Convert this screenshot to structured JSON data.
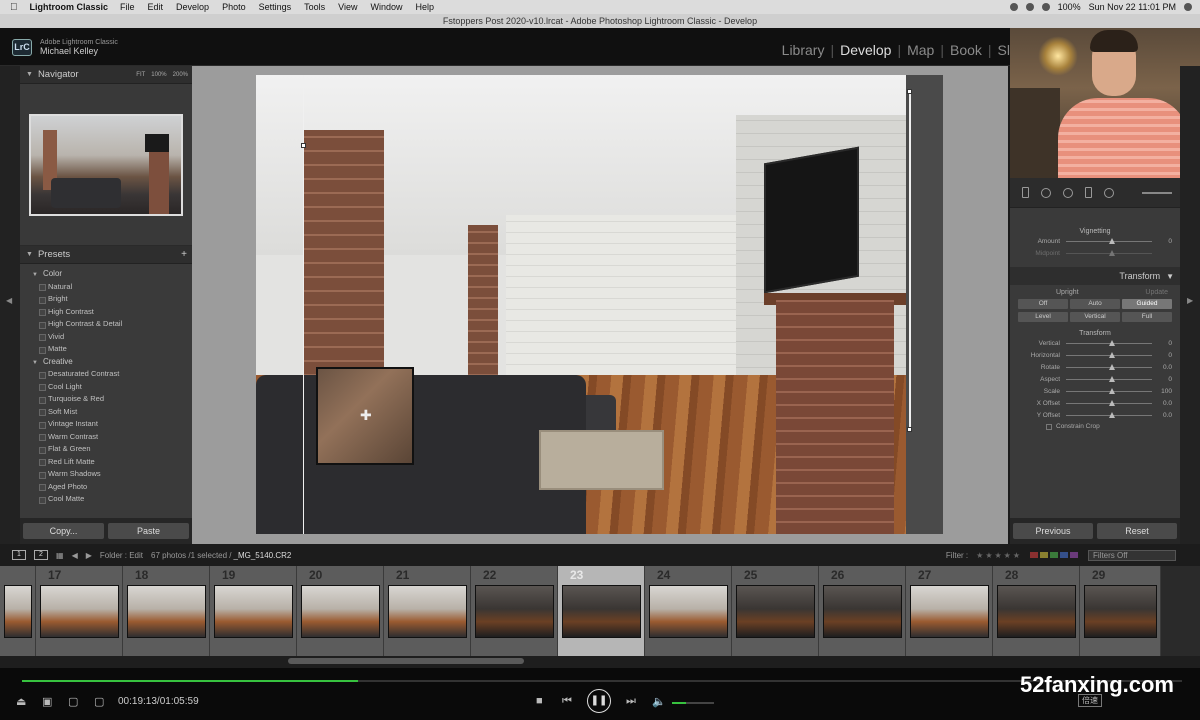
{
  "menubar": {
    "app_name": "Lightroom Classic",
    "items": [
      "File",
      "Edit",
      "Develop",
      "Photo",
      "Settings",
      "Tools",
      "View",
      "Window",
      "Help"
    ],
    "battery": "100%",
    "datetime": "Sun Nov 22  11:01 PM"
  },
  "window": {
    "title": "Fstoppers Post 2020-v10.lrcat - Adobe Photoshop Lightroom Classic - Develop"
  },
  "identity": {
    "badge": "LrC",
    "product": "Adobe Lightroom Classic",
    "user": "Michael Kelley"
  },
  "modules": [
    "Library",
    "Develop",
    "Map",
    "Book",
    "Sl"
  ],
  "active_module": "Develop",
  "navigator": {
    "title": "Navigator",
    "zoom": [
      "FIT",
      "100%",
      "200%"
    ]
  },
  "presets": {
    "title": "Presets",
    "groups": [
      {
        "name": "Color",
        "items": [
          "Natural",
          "Bright",
          "High Contrast",
          "High Contrast & Detail",
          "Vivid",
          "Matte"
        ]
      },
      {
        "name": "Creative",
        "items": [
          "Desaturated Contrast",
          "Cool Light",
          "Turquoise & Red",
          "Soft Mist",
          "Vintage Instant",
          "Warm Contrast",
          "Flat & Green",
          "Red Lift Matte",
          "Warm Shadows",
          "Aged Photo",
          "Cool Matte"
        ]
      }
    ]
  },
  "left_buttons": {
    "copy": "Copy...",
    "paste": "Paste"
  },
  "vignetting": {
    "title": "Vignetting",
    "rows": [
      {
        "name": "Amount",
        "value": "0"
      },
      {
        "name": "Midpoint",
        "value": ""
      }
    ]
  },
  "transform": {
    "title": "Transform",
    "upright_label": "Upright",
    "update_label": "Update",
    "upright_row1": [
      "Off",
      "Auto",
      "Guided"
    ],
    "upright_row2": [
      "Level",
      "Vertical",
      "Full"
    ],
    "active_upright": "Guided",
    "section_label": "Transform",
    "sliders": [
      {
        "name": "Vertical",
        "value": "0"
      },
      {
        "name": "Horizontal",
        "value": "0"
      },
      {
        "name": "Rotate",
        "value": "0.0"
      },
      {
        "name": "Aspect",
        "value": "0"
      },
      {
        "name": "Scale",
        "value": "100"
      },
      {
        "name": "X Offset",
        "value": "0.0"
      },
      {
        "name": "Y Offset",
        "value": "0.0"
      }
    ],
    "constrain": "Constrain Crop"
  },
  "right_buttons": {
    "previous": "Previous",
    "reset": "Reset"
  },
  "filmstrip_header": {
    "views": [
      "1",
      "2"
    ],
    "folder": "Folder : Edit",
    "count": "67 photos /1 selected /",
    "filename": "_MG_5140.CR2",
    "filter_label": "Filter :",
    "filters_off": "Filters Off"
  },
  "filmstrip": {
    "numbers": [
      "",
      "17",
      "18",
      "19",
      "20",
      "21",
      "22",
      "23",
      "24",
      "25",
      "26",
      "27",
      "28",
      "29"
    ],
    "selected": "23"
  },
  "player": {
    "timecode": "00:19:13/01:05:59",
    "progress_fraction": 0.29,
    "volume_fraction": 0.33,
    "speed": "倍速"
  },
  "watermark": "52fanxing.com"
}
